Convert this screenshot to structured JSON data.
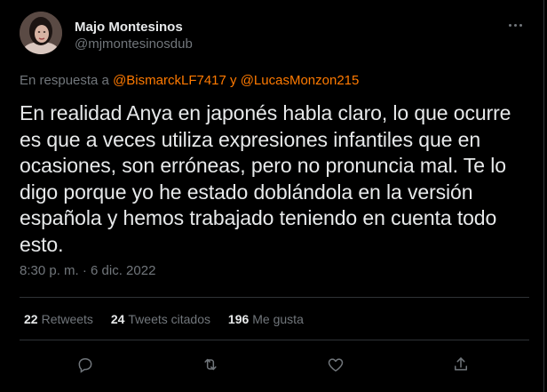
{
  "tweet": {
    "display_name": "Majo Montesinos",
    "handle": "@mjmontesinosdub",
    "reply_prefix": "En respuesta a ",
    "reply_mention_1": "@BismarckLF7417",
    "reply_join": " y ",
    "reply_mention_2": "@LucasMonzon215",
    "text": "En realidad Anya en japonés habla claro, lo que ocurre es que a veces utiliza expresiones infantiles que en ocasiones, son erróneas, pero no pronuncia mal. Te lo digo porque yo he estado doblándola en la versión española y hemos trabajado teniendo en cuenta todo esto.",
    "timestamp": "8:30 p. m. · 6 dic. 2022"
  },
  "stats": {
    "retweets_count": "22",
    "retweets_label": "Retweets",
    "quotes_count": "24",
    "quotes_label": "Tweets citados",
    "likes_count": "196",
    "likes_label": "Me gusta"
  },
  "icons": {
    "more": "more-icon",
    "reply": "reply-icon",
    "retweet": "retweet-icon",
    "like": "like-icon",
    "share": "share-icon"
  },
  "colors": {
    "background": "#000000",
    "text": "#e7e9ea",
    "muted": "#71767b",
    "mention": "#ff7a00",
    "divider": "#2f3336"
  }
}
